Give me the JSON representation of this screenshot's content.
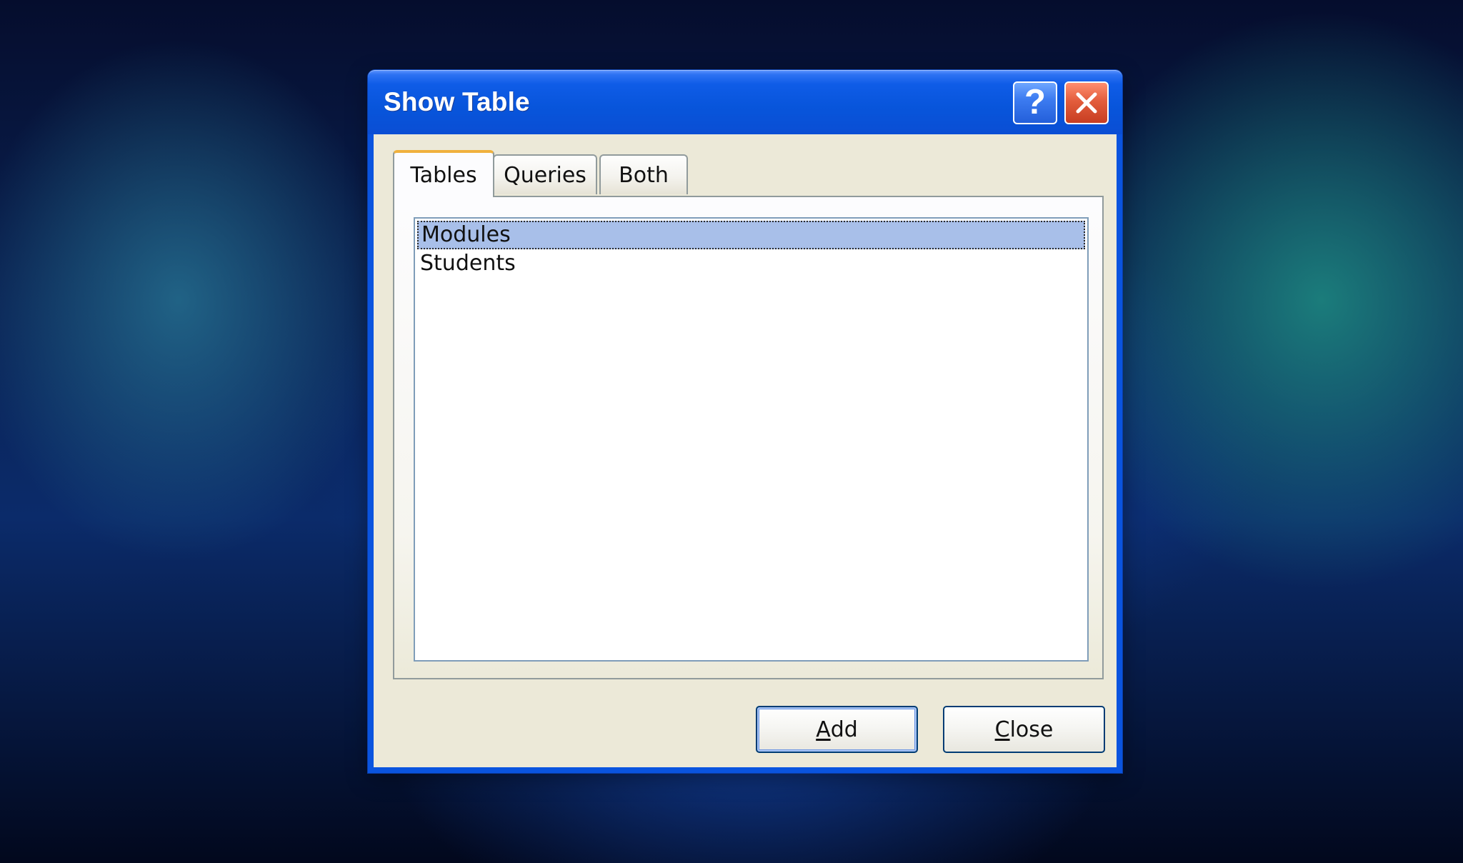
{
  "window": {
    "title": "Show Table",
    "help_button": "?",
    "close_icon": "close-icon"
  },
  "tabs": [
    {
      "label": "Tables",
      "active": true
    },
    {
      "label": "Queries",
      "active": false
    },
    {
      "label": "Both",
      "active": false
    }
  ],
  "list": {
    "items": [
      {
        "label": "Modules",
        "selected": true
      },
      {
        "label": "Students",
        "selected": false
      }
    ]
  },
  "buttons": {
    "add": {
      "mnemonic": "A",
      "rest": "dd"
    },
    "close": {
      "mnemonic": "C",
      "rest": "lose"
    }
  },
  "colors": {
    "titlebar": "#0855db",
    "dialog_face": "#ece9d8",
    "selection": "#a8bfe9",
    "active_tab_accent": "#f0b13d",
    "close_button": "#e35d3c"
  }
}
